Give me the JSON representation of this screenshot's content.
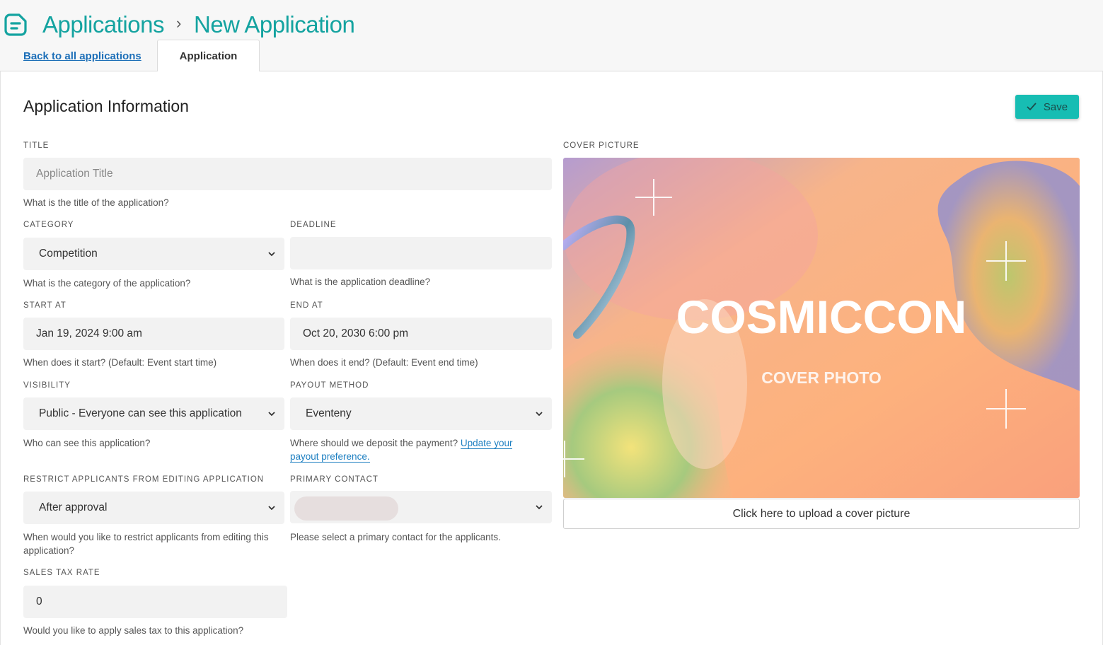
{
  "header": {
    "breadcrumb_root": "Applications",
    "breadcrumb_sep": "›",
    "breadcrumb_current": "New Application",
    "back_link": "Back to all applications",
    "tab_label": "Application"
  },
  "section": {
    "title": "Application Information",
    "save_label": "Save"
  },
  "form": {
    "title": {
      "label": "TITLE",
      "placeholder": "Application Title",
      "help": "What is the title of the application?"
    },
    "category": {
      "label": "CATEGORY",
      "value": "Competition",
      "help": "What is the category of the application?"
    },
    "deadline": {
      "label": "DEADLINE",
      "value": "",
      "help": "What is the application deadline?"
    },
    "start_at": {
      "label": "START AT",
      "value": "Jan 19, 2024 9:00 am",
      "help": "When does it start? (Default: Event start time)"
    },
    "end_at": {
      "label": "END AT",
      "value": "Oct 20, 2030 6:00 pm",
      "help": "When does it end? (Default: Event end time)"
    },
    "visibility": {
      "label": "VISIBILITY",
      "value": "Public - Everyone can see this application",
      "help": "Who can see this application?"
    },
    "payout": {
      "label": "PAYOUT METHOD",
      "value": "Eventeny",
      "help": "Where should we deposit the payment?",
      "help_link": "Update your payout preference."
    },
    "restrict": {
      "label": "RESTRICT APPLICANTS FROM EDITING APPLICATION",
      "value": "After approval",
      "help": "When would you like to restrict applicants from editing this application?"
    },
    "primary_contact": {
      "label": "PRIMARY CONTACT",
      "value": "",
      "help": "Please select a primary contact for the applicants."
    },
    "sales_tax": {
      "label": "SALES TAX RATE",
      "value": "0",
      "help": "Would you like to apply sales tax to this application?"
    }
  },
  "cover": {
    "label": "COVER PICTURE",
    "image_title": "COSMICCON",
    "image_subtitle": "COVER PHOTO",
    "upload_label": "Click here to upload a cover picture"
  },
  "colors": {
    "brand": "#14a3a0",
    "save_button": "#17bdb3",
    "link": "#1d6fb8"
  },
  "icons": {
    "logo": "document-logo-icon",
    "save": "check-icon",
    "dropdown": "chevron-down-icon"
  }
}
